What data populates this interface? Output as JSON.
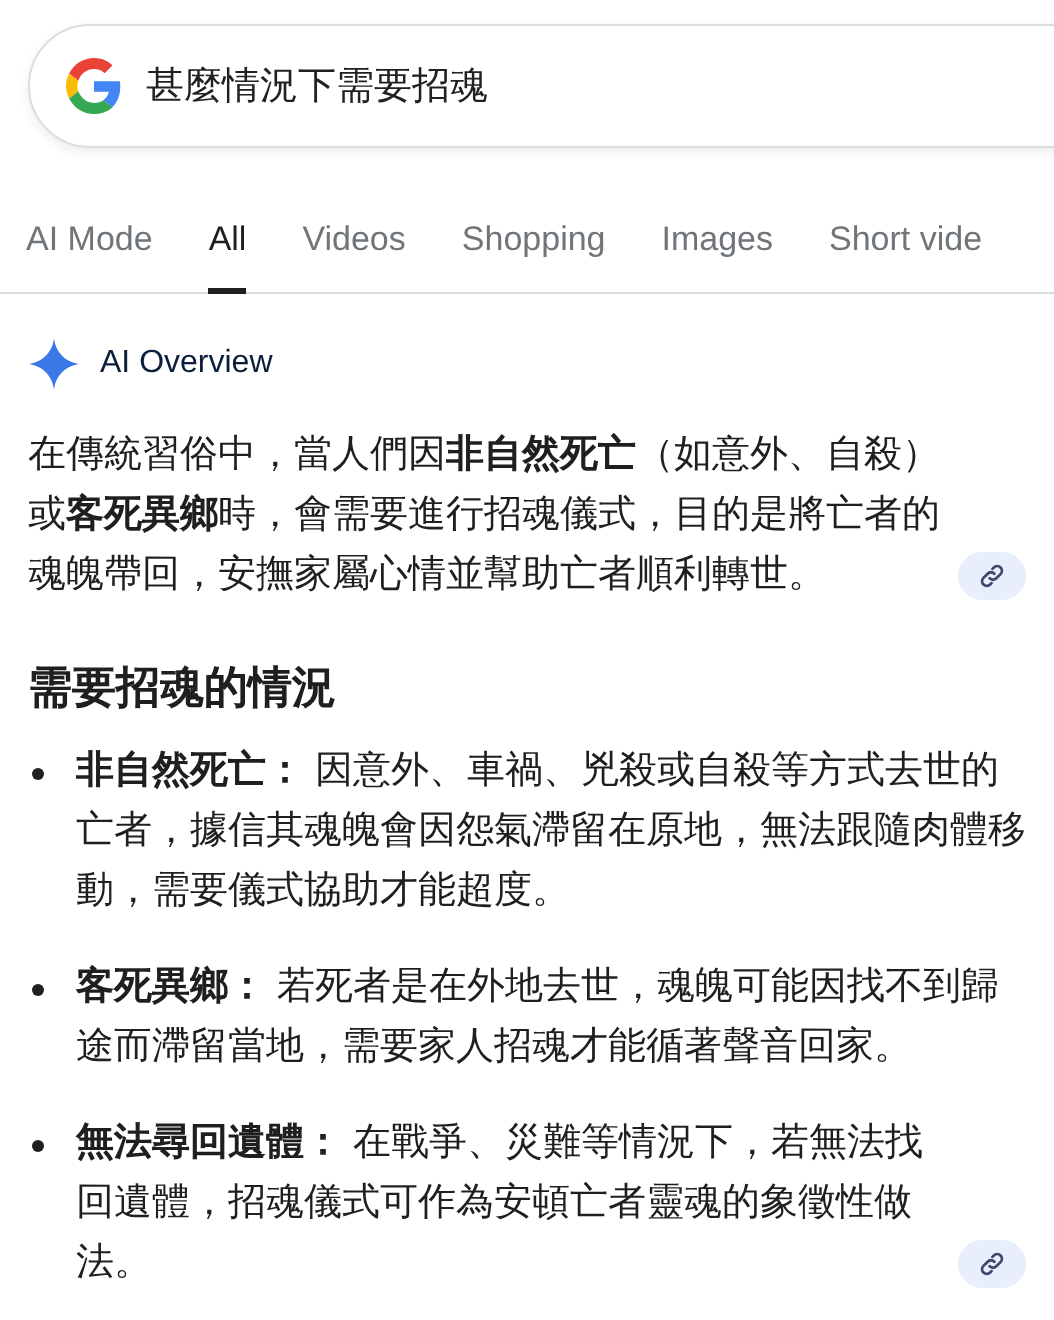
{
  "search": {
    "query": "甚麼情況下需要招魂"
  },
  "tabs": [
    {
      "label": "AI Mode",
      "selected": false
    },
    {
      "label": "All",
      "selected": true
    },
    {
      "label": "Videos",
      "selected": false
    },
    {
      "label": "Shopping",
      "selected": false
    },
    {
      "label": "Images",
      "selected": false
    },
    {
      "label": "Short vide",
      "selected": false
    }
  ],
  "overview": {
    "title": "AI Overview",
    "intro": {
      "text": "在傳統習俗中，當人們因**非自然死亡**（如意外、自殺）或**客死異鄉**時，會需要進行招魂儀式，目的是將亡者的魂魄帶回，安撫家屬心情並幫助亡者順利轉世。",
      "has_link": true
    },
    "heading": "需要招魂的情況",
    "bullets": [
      {
        "term": "非自然死亡：",
        "text": "因意外、車禍、兇殺或自殺等方式去世的亡者，據信其魂魄會因怨氣滯留在原地，無法跟隨肉體移動，需要儀式協助才能超度。",
        "has_link": false
      },
      {
        "term": "客死異鄉：",
        "text": "若死者是在外地去世，魂魄可能因找不到歸途而滯留當地，需要家人招魂才能循著聲音回家。",
        "has_link": false
      },
      {
        "term": "無法尋回遺體：",
        "text": "在戰爭、災難等情況下，若無法找回遺體，招魂儀式可作為安頓亡者靈魂的象徵性做法。",
        "has_link": true
      }
    ]
  }
}
